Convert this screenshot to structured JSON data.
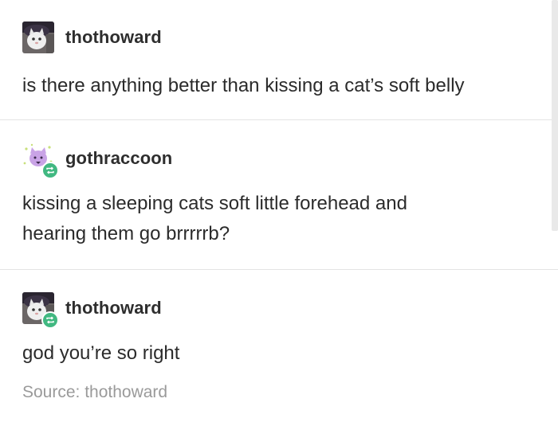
{
  "posts": [
    {
      "username": "thothoward",
      "avatar": "cat-photo-avatar",
      "reblog_icon": "",
      "text": "is there anything better than kissing a cat’s soft belly"
    },
    {
      "username": "gothraccoon",
      "avatar": "purple-cat-illustration-avatar",
      "reblog_icon": "reblog-icon",
      "text_line1": "kissing a sleeping cats soft little forehead and",
      "text_line2": "hearing them go brrrrrb?"
    },
    {
      "username": "thothoward",
      "avatar": "cat-photo-avatar",
      "reblog_icon": "reblog-icon",
      "text": "god you’re so right",
      "source_label": "Source: thothoward"
    }
  ],
  "colors": {
    "text": "#2b2b2b",
    "username": "#2e2e2e",
    "source": "#9a9a9a",
    "divider": "#e3e3e3",
    "reblog_green": "#41b881"
  }
}
